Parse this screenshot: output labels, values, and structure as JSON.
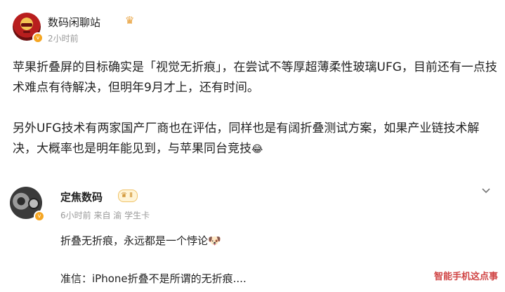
{
  "post": {
    "author": "数码闲聊站",
    "time": "2小时前",
    "paragraph1": "苹果折叠屏的目标确实是「视觉无折痕」，在尝试不等厚超薄柔性玻璃UFG，目前还有一点技术难点有待解决，但明年9月才上，还有时间。",
    "paragraph2": "另外UFG技术有两家国产厂商也在评估，同样也是有阔折叠测试方案，如果产业链技术解决，大概率也是明年能见到，与苹果同台竞技",
    "emoji": "😂"
  },
  "comment": {
    "author": "定焦数码",
    "level_badge": "Ⅱ",
    "meta": "6小时前 来自 渝 学生卡",
    "text": "折叠无折痕，永远都是一个悖论",
    "emoji": "🐶",
    "text2": "准信：iPhone折叠不是所谓的无折痕...."
  },
  "watermark": "智能手机这点事",
  "colors": {
    "meta": "#999999",
    "watermark": "#d04545",
    "badge": "#f5a623"
  }
}
